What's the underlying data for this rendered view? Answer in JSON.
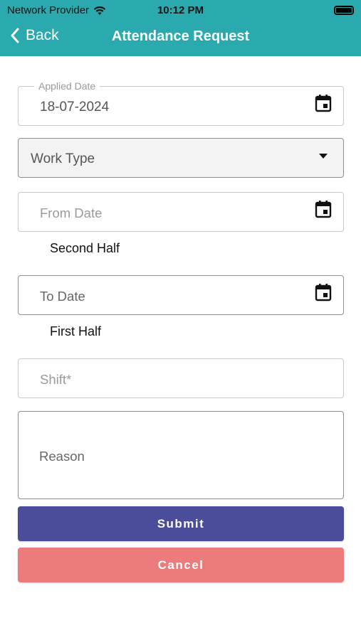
{
  "status_bar": {
    "carrier": "Network Provider",
    "time": "10:12 PM"
  },
  "nav": {
    "back_label": "Back",
    "title": "Attendance Request"
  },
  "form": {
    "applied_date": {
      "label": "Applied Date",
      "value": "18-07-2024"
    },
    "work_type": {
      "placeholder": "Work Type"
    },
    "from_date": {
      "placeholder": "From Date",
      "half": "Second Half"
    },
    "to_date": {
      "placeholder": "To Date",
      "half": "First Half"
    },
    "shift": {
      "placeholder": "Shift*"
    },
    "reason": {
      "placeholder": "Reason"
    }
  },
  "buttons": {
    "submit": "Submit",
    "cancel": "Cancel"
  },
  "colors": {
    "header": "#2aaaaf",
    "submit": "#4b4c9a",
    "cancel": "#ee7b7c"
  },
  "icons": [
    "wifi-icon",
    "battery-icon",
    "chevron-left-icon",
    "calendar-icon",
    "caret-down-icon"
  ]
}
